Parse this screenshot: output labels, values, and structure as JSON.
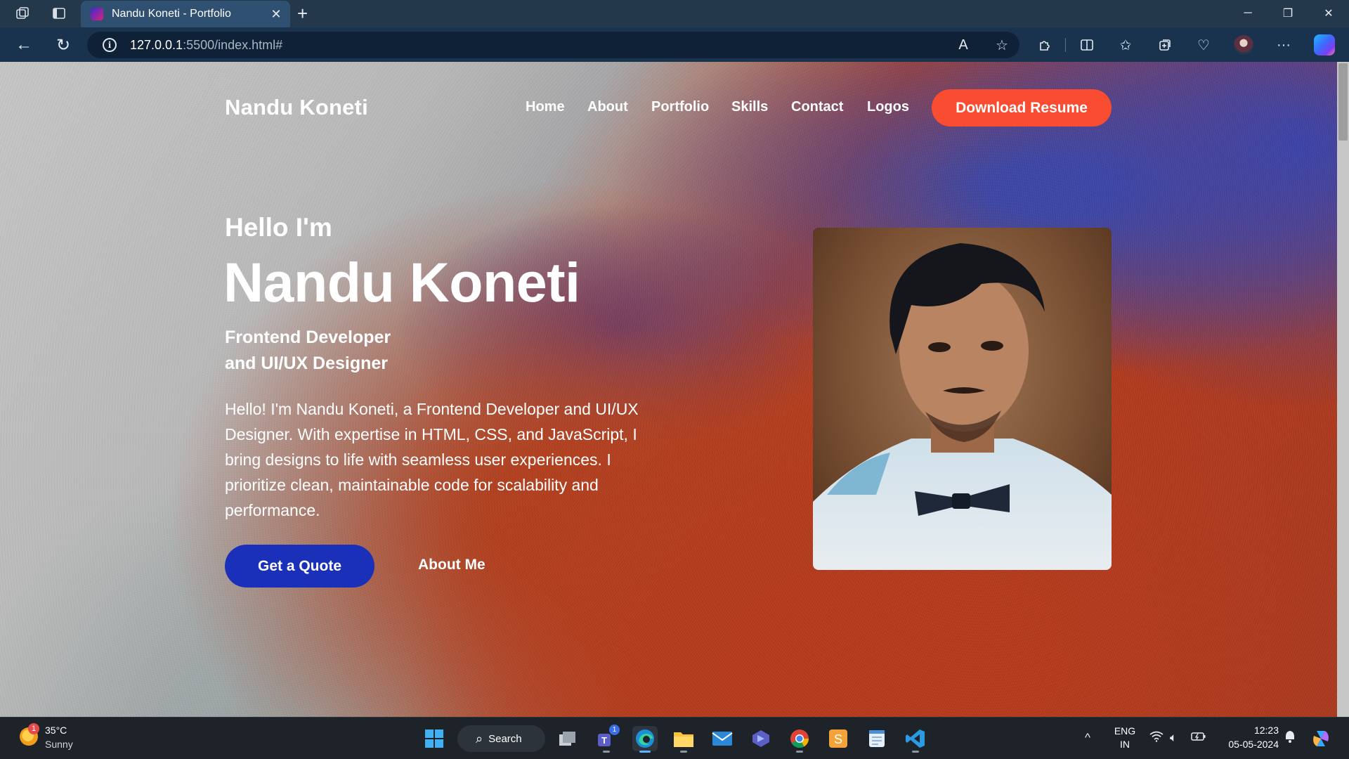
{
  "browser": {
    "tab_title": "Nandu Koneti - Portfolio",
    "url_host": "127.0.0.1",
    "url_path": ":5500/index.html#",
    "icons": [
      "workspaces-icon",
      "tab-actions-icon",
      "back-icon",
      "refresh-icon",
      "read-aloud-icon",
      "favorite-star-icon",
      "extensions-icon",
      "split-screen-icon",
      "favorites-icon",
      "collections-icon",
      "browser-essentials-icon",
      "profile-avatar",
      "more-icon",
      "copilot-icon"
    ]
  },
  "site": {
    "brand": "Nandu Koneti",
    "nav": [
      "Home",
      "About",
      "Portfolio",
      "Skills",
      "Contact",
      "Logos"
    ],
    "resume_button": "Download Resume",
    "greeting": "Hello I'm",
    "name": "Nandu Koneti",
    "role_line1": "Frontend Developer",
    "role_line2": "and UI/UX Designer",
    "bio": "Hello! I'm Nandu Koneti, a Frontend Developer and UI/UX Designer. With expertise in HTML, CSS, and JavaScript, I bring designs to life with seamless user experiences. I prioritize clean, maintainable code for scalability and performance.",
    "quote_button": "Get a Quote",
    "about_button": "About Me"
  },
  "taskbar": {
    "weather_badge": "1",
    "temperature": "35°C",
    "weather": "Sunny",
    "search_label": "Search",
    "teams_badge": "1",
    "lang_line1": "ENG",
    "lang_line2": "IN",
    "time": "12:23",
    "date": "05-05-2024"
  },
  "colors": {
    "accent_orange": "#fa4c30",
    "accent_blue": "#1b30b9"
  }
}
